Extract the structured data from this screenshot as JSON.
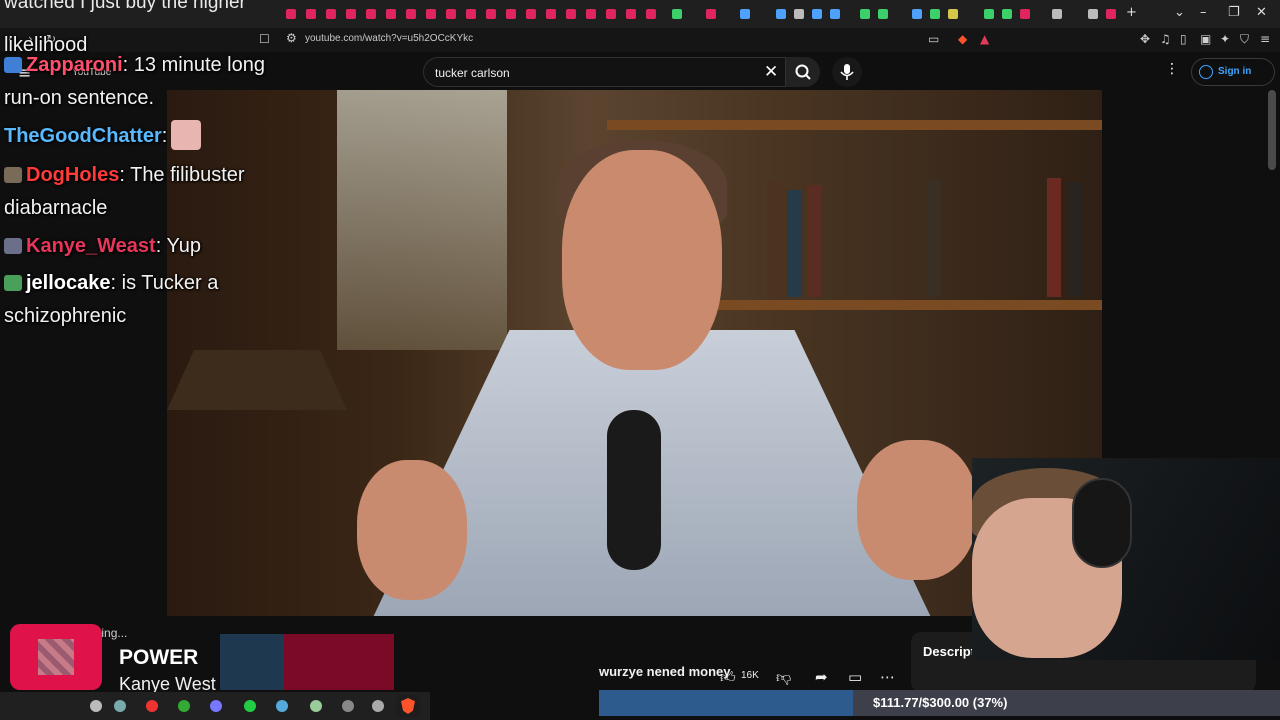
{
  "overflow_caption": "watched I just buy the higher",
  "chat_wrap_word": "likelihood",
  "browser": {
    "url": "youtube.com/watch?v=u5h2OCcKYkc"
  },
  "youtube": {
    "logo_text": "YouTube",
    "search_value": "tucker carlson",
    "signin_label": "Sign in",
    "video_title": "wurzye nened money",
    "like_count": "16K",
    "description_label": "Descript",
    "loading_label": "ading..."
  },
  "chat": [
    {
      "user": "Zapparoni",
      "user_color": "#ff4f6d",
      "message": ": 13 minute long"
    },
    {
      "user": "",
      "user_color": "",
      "message": "run-on sentence."
    },
    {
      "user": "TheGoodChatter",
      "user_color": "#58b9ff",
      "message": ":"
    },
    {
      "user": "DogHoles",
      "user_color": "#ff3a3a",
      "message": ": The filibuster"
    },
    {
      "user": "",
      "user_color": "",
      "message": "diabarnacle"
    },
    {
      "user": "Kanye_Weast",
      "user_color": "#e8365a",
      "message": ": Yup"
    },
    {
      "user": "jellocake",
      "user_color": "#ffffff",
      "message": ": is Tucker a"
    },
    {
      "user": "",
      "user_color": "",
      "message": "schizophrenic"
    }
  ],
  "now_playing": {
    "title": "POWER",
    "artist": "Kanye West",
    "accent": "#e0124a"
  },
  "donation_goal": {
    "current": "$111.77",
    "target": "$300.00",
    "percent_label": "(37%)",
    "fraction": 0.37,
    "display": "$111.77/$300.00 (37%)"
  },
  "icons": {
    "menu": "menu-icon",
    "clear": "close-icon",
    "search": "search-icon",
    "mic": "microphone-icon",
    "more": "more-vert-icon",
    "account": "account-circle-icon"
  }
}
